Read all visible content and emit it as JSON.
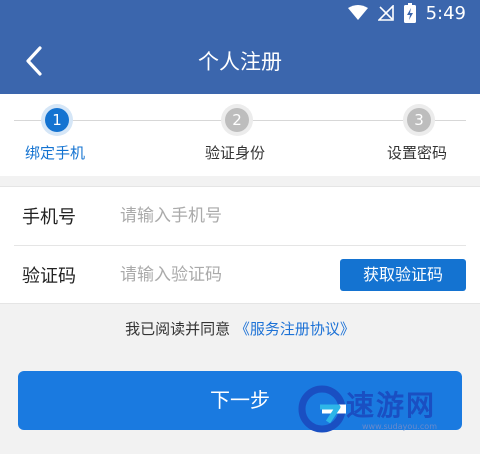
{
  "status_bar": {
    "time": "5:49"
  },
  "header": {
    "title": "个人注册"
  },
  "steps": [
    {
      "number": "1",
      "label": "绑定手机",
      "active": true
    },
    {
      "number": "2",
      "label": "验证身份",
      "active": false
    },
    {
      "number": "3",
      "label": "设置密码",
      "active": false
    }
  ],
  "form": {
    "phone": {
      "label": "手机号",
      "placeholder": "请输入手机号",
      "value": ""
    },
    "code": {
      "label": "验证码",
      "placeholder": "请输入验证码",
      "value": ""
    },
    "get_code_label": "获取验证码"
  },
  "agreement": {
    "prefix": "我已阅读并同意",
    "link": "《服务注册协议》"
  },
  "next_button": "下一步",
  "watermark": {
    "text": "速游网",
    "sub": "www.sudayou.com"
  },
  "colors": {
    "header": "#3b66ad",
    "accent": "#1a7ae0",
    "step_active": "#1473d1",
    "step_inactive": "#bdbdbd"
  }
}
